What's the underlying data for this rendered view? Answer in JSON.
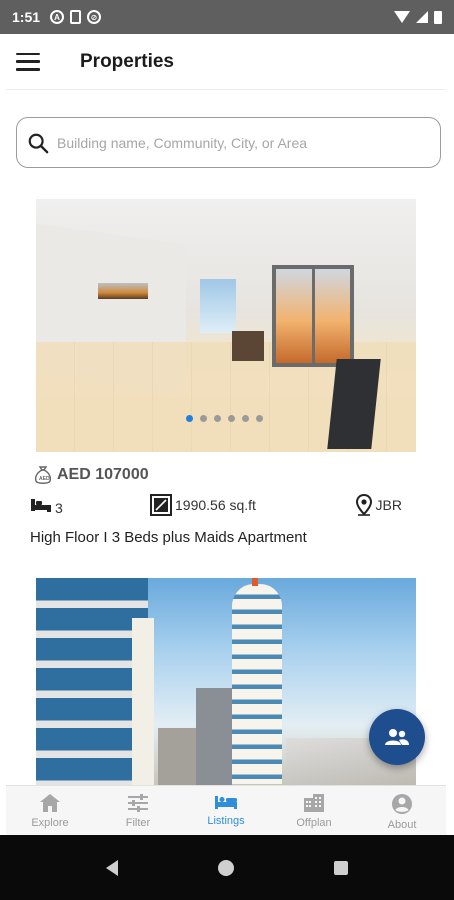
{
  "status_bar": {
    "time": "1:51",
    "icons": [
      "a-icon",
      "sd-card-icon",
      "sync-off-icon"
    ],
    "right_icons": [
      "wifi-icon",
      "signal-icon",
      "battery-icon"
    ]
  },
  "app_bar": {
    "title": "Properties",
    "menu_icon": "hamburger-icon"
  },
  "search": {
    "placeholder": "Building name, Community, City, or Area",
    "icon": "search-icon"
  },
  "listings": [
    {
      "price": "AED 107000",
      "beds": "3",
      "area": "1990.56 sq.ft",
      "location": "JBR",
      "title": "High Floor I 3 Beds plus Maids Apartment",
      "photo_count": 6,
      "active_photo_index": 0
    },
    {
      "price": "",
      "beds": "",
      "area": "",
      "location": "",
      "title": ""
    }
  ],
  "fab": {
    "icon": "agents-icon",
    "color": "#1f4e8f"
  },
  "bottom_nav": {
    "items": [
      {
        "label": "Explore",
        "icon": "home-icon"
      },
      {
        "label": "Filter",
        "icon": "sliders-icon"
      },
      {
        "label": "Listings",
        "icon": "bed-icon"
      },
      {
        "label": "Offplan",
        "icon": "building-icon"
      },
      {
        "label": "About",
        "icon": "person-icon"
      }
    ],
    "active": "Listings",
    "active_color": "#2f8fd8"
  },
  "system_nav": [
    "back-icon",
    "home-circle-icon",
    "recents-icon"
  ]
}
